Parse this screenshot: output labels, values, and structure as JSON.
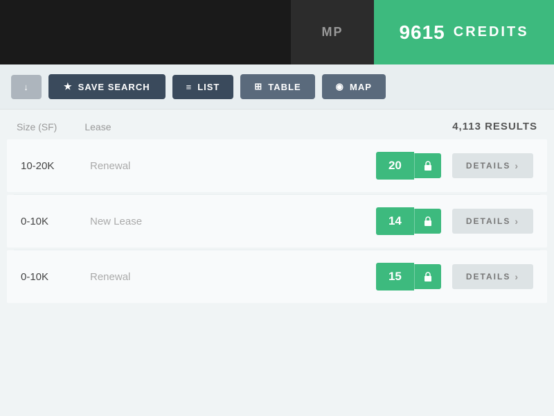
{
  "header": {
    "user_initials": "MP",
    "credits_count": "9615",
    "credits_label": "CREDITS"
  },
  "toolbar": {
    "download_icon": "↓",
    "save_search_label": "SAVE SEARCH",
    "star_icon": "★",
    "list_label": "LIST",
    "list_icon": "≡",
    "table_label": "TABLE",
    "table_icon": "⊞",
    "map_label": "MAP",
    "map_icon": "◉"
  },
  "results": {
    "filters": [
      {
        "label": "Size (SF)"
      },
      {
        "label": "Lease"
      }
    ],
    "count_text": "4,113 RESULTS"
  },
  "list_items": [
    {
      "size": "10-20K",
      "lease": "Renewal",
      "score": "20",
      "id": 1
    },
    {
      "size": "0-10K",
      "lease": "New Lease",
      "score": "14",
      "id": 2
    },
    {
      "size": "0-10K",
      "lease": "Renewal",
      "score": "15",
      "id": 3
    }
  ],
  "details_label": "DETAILS",
  "details_chevron": "›"
}
